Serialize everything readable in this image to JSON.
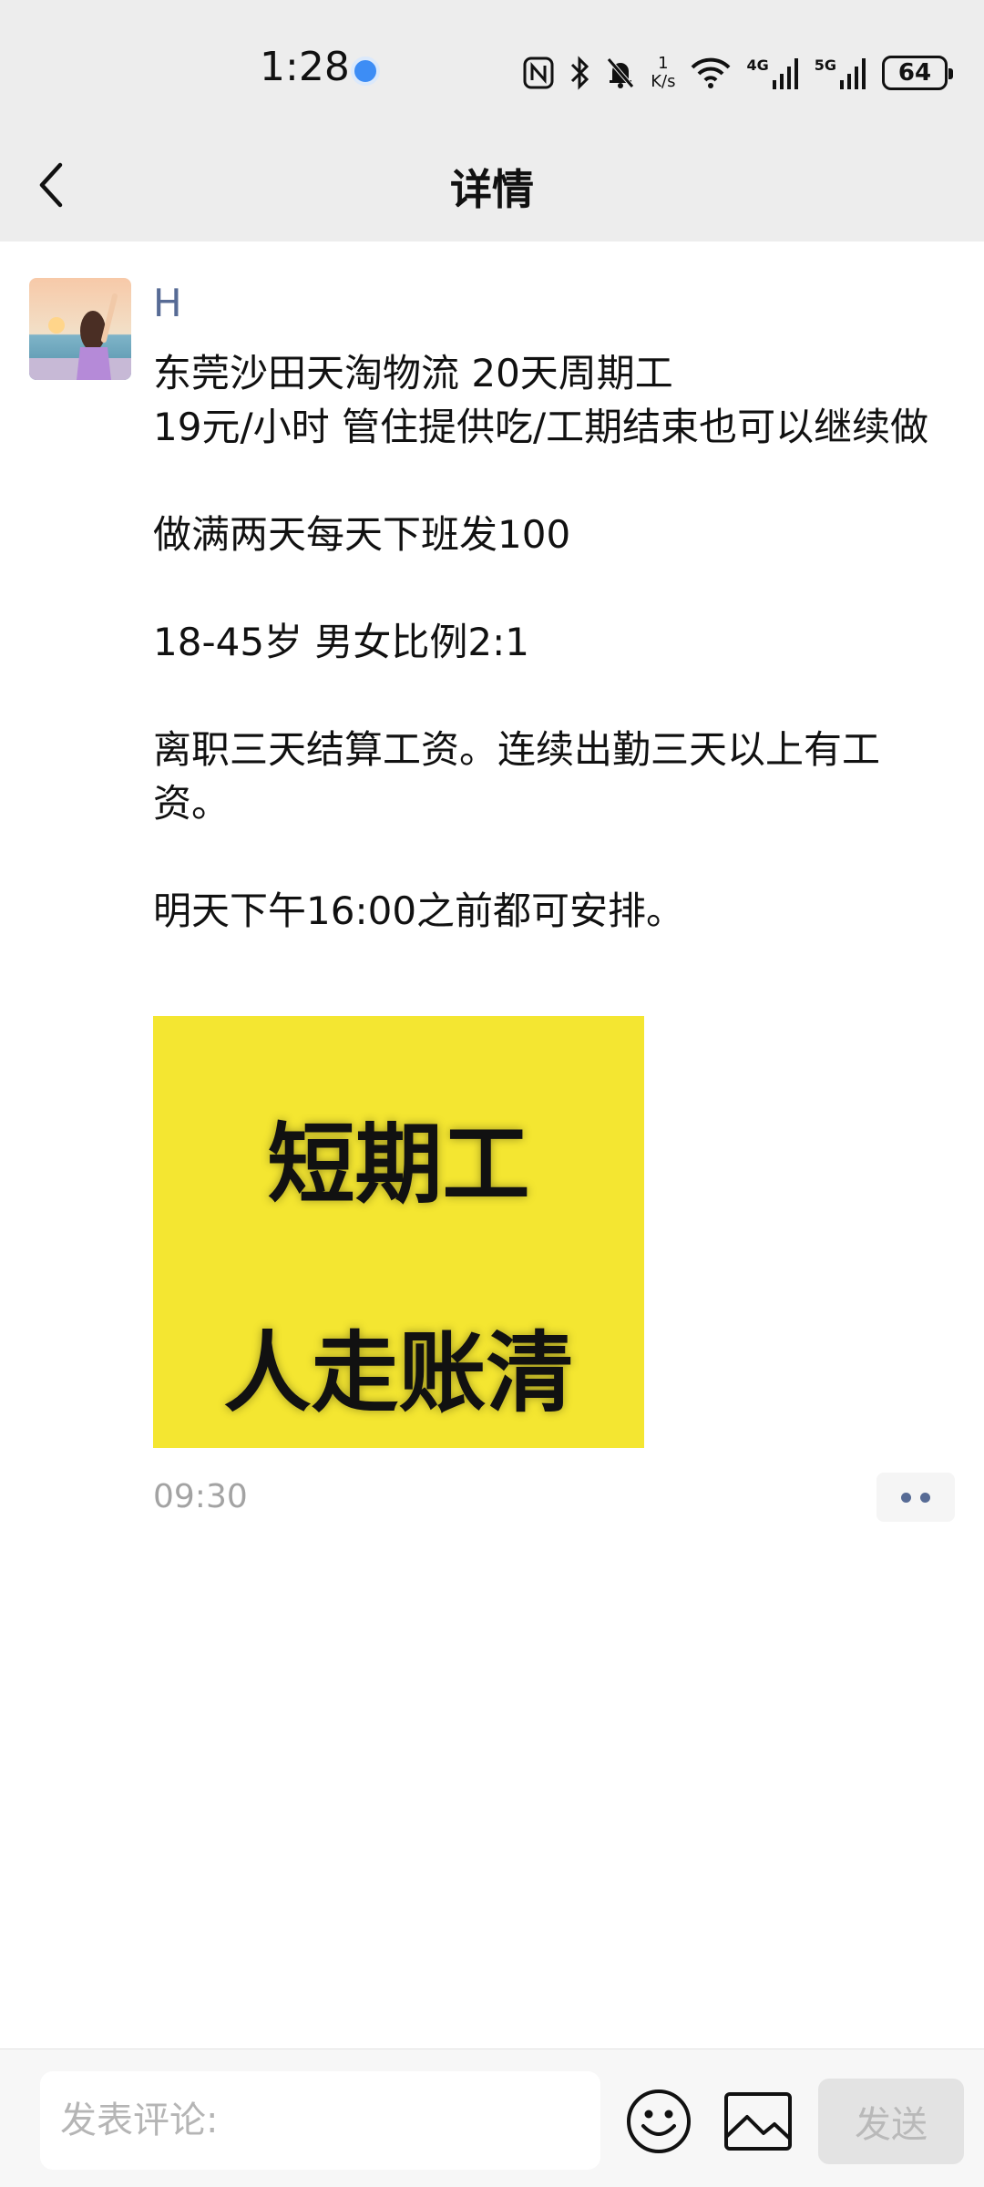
{
  "status_bar": {
    "time": "1:28",
    "net_speed_value": "1",
    "net_speed_unit": "K/s",
    "signal_1_label": "4G",
    "signal_2_label": "5G",
    "battery": "64"
  },
  "nav": {
    "title": "详情"
  },
  "post": {
    "author": "H",
    "lines": [
      "东莞沙田天淘物流  20天周期工",
      "19元/小时   管住提供吃/工期结束也可以继续做",
      "",
      "做满两天每天下班发100",
      "",
      "18-45岁   男女比例2:1",
      "",
      "离职三天结算工资。连续出勤三天以上有工资。",
      "",
      "明天下午16:00之前都可安排。"
    ],
    "image_text_line1": "短期工",
    "image_text_line2": "人走账清",
    "image_bg_color": "#f4e631",
    "time": "09:30"
  },
  "comment_bar": {
    "placeholder": "发表评论:",
    "send_label": "发送"
  },
  "icons": {
    "back": "chevron-left-icon",
    "emoji": "smiley-icon",
    "image": "image-icon",
    "more": "more-dots-icon"
  },
  "colors": {
    "author_link": "#576b95",
    "header_bg": "#ededed",
    "status_dot": "#3d8df5"
  }
}
